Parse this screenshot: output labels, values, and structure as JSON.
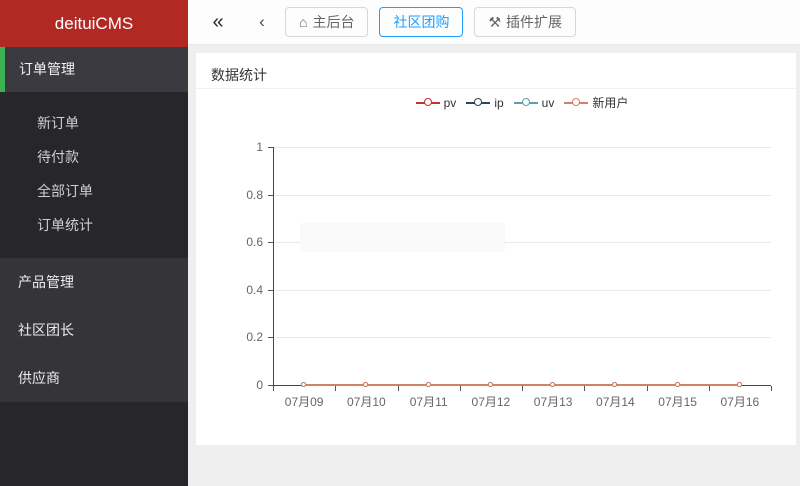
{
  "sidebar": {
    "brand": "deituiCMS",
    "brand_bg": "#b22924",
    "accent_green": "#3eb152",
    "active_section": {
      "label": "订单管理"
    },
    "submenu": [
      {
        "label": "新订单"
      },
      {
        "label": "待付款"
      },
      {
        "label": "全部订单"
      },
      {
        "label": "订单统计"
      }
    ],
    "sections": [
      {
        "label": "产品管理"
      },
      {
        "label": "社区团长"
      },
      {
        "label": "供应商"
      }
    ]
  },
  "topbar": {
    "collapse_icon": "«",
    "back_icon": "‹",
    "active_color": "#1E9FFF",
    "tabs": [
      {
        "label": "主后台",
        "icon": "home-icon",
        "active": false
      },
      {
        "label": "社区团购",
        "icon": null,
        "active": true
      },
      {
        "label": "插件扩展",
        "icon": "tools-icon",
        "active": false
      }
    ]
  },
  "panel": {
    "title": "数据统计"
  },
  "chart_data": {
    "type": "line",
    "title": "数据统计",
    "categories": [
      "07月09",
      "07月10",
      "07月11",
      "07月12",
      "07月13",
      "07月14",
      "07月15",
      "07月16"
    ],
    "series": [
      {
        "name": "pv",
        "color": "#c23531",
        "values": [
          0,
          0,
          0,
          0,
          0,
          0,
          0,
          0
        ]
      },
      {
        "name": "ip",
        "color": "#2f4554",
        "values": [
          0,
          0,
          0,
          0,
          0,
          0,
          0,
          0
        ]
      },
      {
        "name": "uv",
        "color": "#61a0a8",
        "values": [
          0,
          0,
          0,
          0,
          0,
          0,
          0,
          0
        ]
      },
      {
        "name": "新用户",
        "color": "#d48265",
        "values": [
          0,
          0,
          0,
          0,
          0,
          0,
          0,
          0
        ]
      }
    ],
    "xlabel": "",
    "ylabel": "",
    "ylim": [
      0,
      1
    ],
    "yticks": [
      0,
      0.2,
      0.4,
      0.6,
      0.8,
      1
    ],
    "grid": true,
    "legend_position": "top-center"
  }
}
